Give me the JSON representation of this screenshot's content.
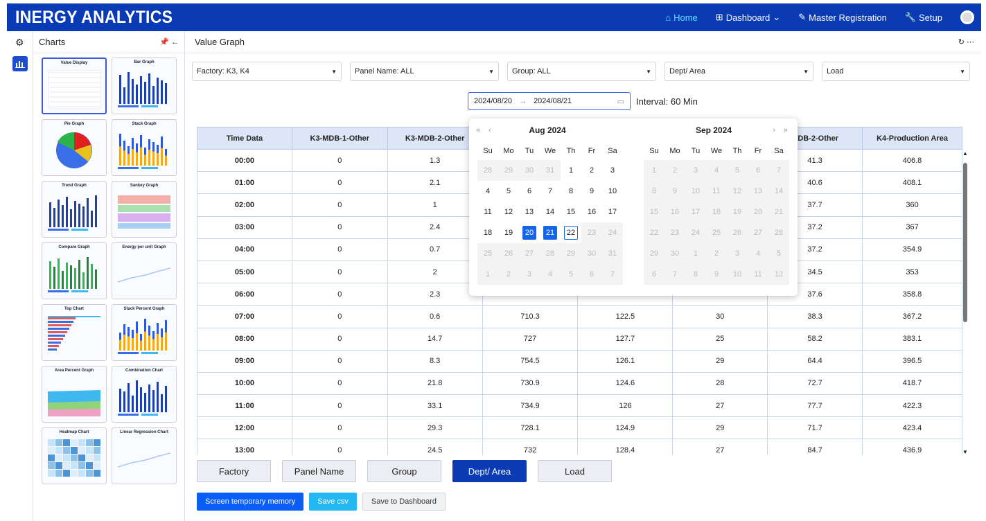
{
  "app": {
    "brand": "INERGY ANALYTICS"
  },
  "nav": [
    {
      "label": "Home",
      "icon": "home-icon",
      "active": true
    },
    {
      "label": "Dashboard",
      "icon": "dashboard-icon",
      "active": false
    },
    {
      "label": "Master Registration",
      "icon": "edit-icon",
      "active": false
    },
    {
      "label": "Setup",
      "icon": "wrench-icon",
      "active": false
    }
  ],
  "charts_panel": {
    "title": "Charts",
    "items": [
      "Value Display",
      "Bar Graph",
      "Pie Graph",
      "Stack Graph",
      "Trend Graph",
      "Sankey Graph",
      "Compare Graph",
      "Energy per unit Graph",
      "Top Chart",
      "Stack Percent Graph",
      "Area Percent Graph",
      "Combination Chart",
      "Heatmap Chart",
      "Linear Regression Chart"
    ],
    "selected": "Value Display"
  },
  "main": {
    "title": "Value Graph"
  },
  "filters": [
    {
      "value": "Factory: K3, K4"
    },
    {
      "value": "Panel Name: ALL"
    },
    {
      "value": "Group: ALL"
    },
    {
      "value": "Dept/ Area"
    },
    {
      "value": "Load"
    }
  ],
  "date_range": {
    "start": "2024/08/20",
    "end": "2024/08/21",
    "interval": "Interval: 60 Min"
  },
  "table": {
    "headers": [
      "Time Data",
      "K3-MDB-1-Other",
      "K3-MDB-2-Other",
      "",
      "",
      "",
      "MDB-2-Other",
      "K4-Production Area"
    ],
    "rows": [
      [
        "00:00",
        "0",
        "1.3",
        "",
        "",
        "",
        "41.3",
        "406.8"
      ],
      [
        "01:00",
        "0",
        "2.1",
        "",
        "",
        "",
        "40.6",
        "408.1"
      ],
      [
        "02:00",
        "0",
        "1",
        "",
        "",
        "",
        "37.7",
        "360"
      ],
      [
        "03:00",
        "0",
        "2.4",
        "",
        "",
        "",
        "37.2",
        "367"
      ],
      [
        "04:00",
        "0",
        "0.7",
        "",
        "",
        "",
        "37.2",
        "354.9"
      ],
      [
        "05:00",
        "0",
        "2",
        "",
        "",
        "",
        "34.5",
        "353"
      ],
      [
        "06:00",
        "0",
        "2.3",
        "",
        "",
        "",
        "37.6",
        "358.8"
      ],
      [
        "07:00",
        "0",
        "0.6",
        "710.3",
        "122.5",
        "30",
        "38.3",
        "367.2"
      ],
      [
        "08:00",
        "0",
        "14.7",
        "727",
        "127.7",
        "25",
        "58.2",
        "383.1"
      ],
      [
        "09:00",
        "0",
        "8.3",
        "754.5",
        "126.1",
        "29",
        "64.4",
        "396.5"
      ],
      [
        "10:00",
        "0",
        "21.8",
        "730.9",
        "124.6",
        "28",
        "72.7",
        "418.7"
      ],
      [
        "11:00",
        "0",
        "33.1",
        "734.9",
        "126",
        "27",
        "77.7",
        "422.3"
      ],
      [
        "12:00",
        "0",
        "29.3",
        "728.1",
        "124.9",
        "29",
        "71.7",
        "423.4"
      ],
      [
        "13:00",
        "0",
        "24.5",
        "732",
        "128.4",
        "27",
        "84.7",
        "436.9"
      ]
    ]
  },
  "tabs": [
    {
      "label": "Factory",
      "active": false
    },
    {
      "label": "Panel Name",
      "active": false
    },
    {
      "label": "Group",
      "active": false
    },
    {
      "label": "Dept/ Area",
      "active": true
    },
    {
      "label": "Load",
      "active": false
    }
  ],
  "actions": {
    "memory": "Screen temporary memory",
    "csv": "Save csv",
    "dashboard": "Save to Dashboard"
  },
  "calendar": {
    "weekdays": [
      "Su",
      "Mo",
      "Tu",
      "We",
      "Th",
      "Fr",
      "Sa"
    ],
    "left": {
      "title": "Aug  2024",
      "days": [
        [
          "28",
          "o"
        ],
        [
          "29",
          "o"
        ],
        [
          "30",
          "o"
        ],
        [
          "31",
          "o"
        ],
        [
          "1",
          ""
        ],
        [
          "2",
          ""
        ],
        [
          "3",
          ""
        ],
        [
          "4",
          ""
        ],
        [
          "5",
          ""
        ],
        [
          "6",
          ""
        ],
        [
          "7",
          ""
        ],
        [
          "8",
          ""
        ],
        [
          "9",
          ""
        ],
        [
          "10",
          ""
        ],
        [
          "11",
          ""
        ],
        [
          "12",
          ""
        ],
        [
          "13",
          ""
        ],
        [
          "14",
          ""
        ],
        [
          "15",
          ""
        ],
        [
          "16",
          ""
        ],
        [
          "17",
          ""
        ],
        [
          "18",
          ""
        ],
        [
          "19",
          ""
        ],
        [
          "20",
          "p"
        ],
        [
          "21",
          "p"
        ],
        [
          "22",
          "t"
        ],
        [
          "23",
          "o"
        ],
        [
          "24",
          "o"
        ],
        [
          "25",
          "o"
        ],
        [
          "26",
          "o"
        ],
        [
          "27",
          "o"
        ],
        [
          "28",
          "o"
        ],
        [
          "29",
          "o"
        ],
        [
          "30",
          "o"
        ],
        [
          "31",
          "o"
        ],
        [
          "1",
          "o"
        ],
        [
          "2",
          "o"
        ],
        [
          "3",
          "o"
        ],
        [
          "4",
          "o"
        ],
        [
          "5",
          "o"
        ],
        [
          "6",
          "o"
        ],
        [
          "7",
          "o"
        ]
      ]
    },
    "right": {
      "title": "Sep  2024",
      "days": [
        [
          "1",
          "o"
        ],
        [
          "2",
          "o"
        ],
        [
          "3",
          "o"
        ],
        [
          "4",
          "o"
        ],
        [
          "5",
          "o"
        ],
        [
          "6",
          "o"
        ],
        [
          "7",
          "o"
        ],
        [
          "8",
          "o"
        ],
        [
          "9",
          "o"
        ],
        [
          "10",
          "o"
        ],
        [
          "11",
          "o"
        ],
        [
          "12",
          "o"
        ],
        [
          "13",
          "o"
        ],
        [
          "14",
          "o"
        ],
        [
          "15",
          "o"
        ],
        [
          "16",
          "o"
        ],
        [
          "17",
          "o"
        ],
        [
          "18",
          "o"
        ],
        [
          "19",
          "o"
        ],
        [
          "20",
          "o"
        ],
        [
          "21",
          "o"
        ],
        [
          "22",
          "o"
        ],
        [
          "23",
          "o"
        ],
        [
          "24",
          "o"
        ],
        [
          "25",
          "o"
        ],
        [
          "26",
          "o"
        ],
        [
          "27",
          "o"
        ],
        [
          "28",
          "o"
        ],
        [
          "29",
          "o"
        ],
        [
          "30",
          "o"
        ],
        [
          "1",
          "o"
        ],
        [
          "2",
          "o"
        ],
        [
          "3",
          "o"
        ],
        [
          "4",
          "o"
        ],
        [
          "5",
          "o"
        ],
        [
          "6",
          "o"
        ],
        [
          "7",
          "o"
        ],
        [
          "8",
          "o"
        ],
        [
          "9",
          "o"
        ],
        [
          "10",
          "o"
        ],
        [
          "11",
          "o"
        ],
        [
          "12",
          "o"
        ]
      ]
    }
  },
  "colors": {
    "brand": "#0a3bb5",
    "accent": "#1565e8",
    "home_active": "#5fe3ff"
  }
}
